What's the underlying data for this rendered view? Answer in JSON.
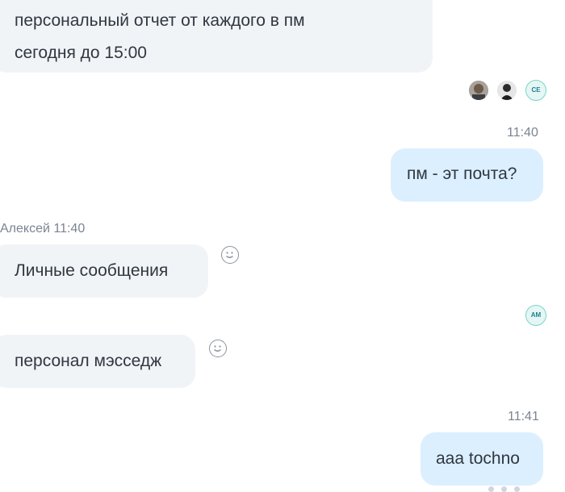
{
  "messages": {
    "first_incoming": {
      "line1": "персональный отчет от каждого в пм",
      "line2": "сегодня до 15:00"
    },
    "read_receipts": {
      "initials": "CE"
    },
    "question": {
      "time": "11:40",
      "text": "пм - эт почта?"
    },
    "reply_group": {
      "sender_and_time": "Алексей 11:40",
      "first": "Личные сообщения",
      "second": "персонал мэсседж",
      "reader_initials": "AM"
    },
    "last_outgoing": {
      "time": "11:41",
      "text": "aaa tochno"
    }
  },
  "icons": {
    "reaction": "smiley-reaction-icon",
    "avatar1": "user-avatar-photo",
    "avatar2": "user-avatar-dark"
  },
  "colors": {
    "incoming_bubble": "#f1f4f7",
    "outgoing_bubble": "#dcefff",
    "meta_text": "#7a8591"
  }
}
